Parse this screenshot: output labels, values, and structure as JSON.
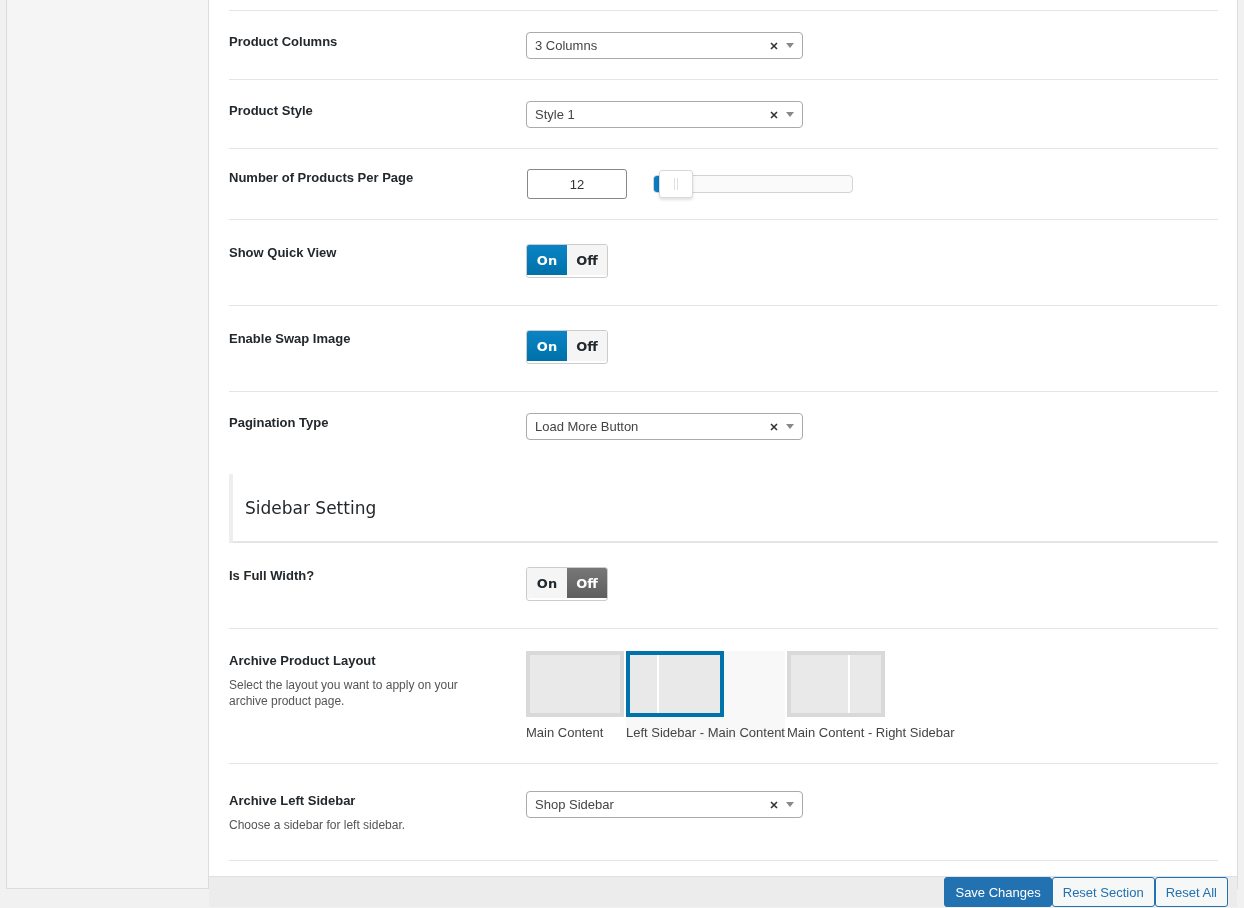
{
  "settings": [
    {
      "kind": "select",
      "label": "Product Columns",
      "value": "3 Columns"
    },
    {
      "kind": "select",
      "label": "Product Style",
      "value": "Style 1"
    },
    {
      "kind": "slider",
      "label": "Number of Products Per Page",
      "value": "12",
      "level": 0.03
    },
    {
      "kind": "toggle",
      "label": "Show Quick View",
      "on_label": "On",
      "off_label": "Off",
      "on": true
    },
    {
      "kind": "toggle",
      "label": "Enable Swap Image",
      "on_label": "On",
      "off_label": "Off",
      "on": true
    },
    {
      "kind": "select",
      "label": "Pagination Type",
      "value": "Load More Button"
    },
    {
      "kind": "heading",
      "label": "Sidebar Setting"
    },
    {
      "kind": "toggle",
      "label": "Is Full Width?",
      "on_label": "On",
      "off_label": "Off",
      "on": false
    },
    {
      "kind": "image_select",
      "label": "Archive Product Layout",
      "description": "Select the layout you want to apply on your archive product page.",
      "options": [
        {
          "kind": "full",
          "label": "Main Content",
          "selected": false
        },
        {
          "kind": "left",
          "label": "Left Sidebar - Main Content",
          "selected": true
        },
        {
          "kind": "right",
          "label": "Main Content - Right Sidebar",
          "selected": false
        }
      ]
    },
    {
      "kind": "select",
      "label": "Archive Left Sidebar",
      "description": "Choose a sidebar for left sidebar.",
      "value": "Shop Sidebar"
    }
  ],
  "footer": {
    "buttons": [
      {
        "kind": "primary",
        "label": "Save Changes"
      },
      {
        "kind": "secondary",
        "label": "Reset Section"
      },
      {
        "kind": "secondary",
        "label": "Reset All"
      }
    ]
  }
}
